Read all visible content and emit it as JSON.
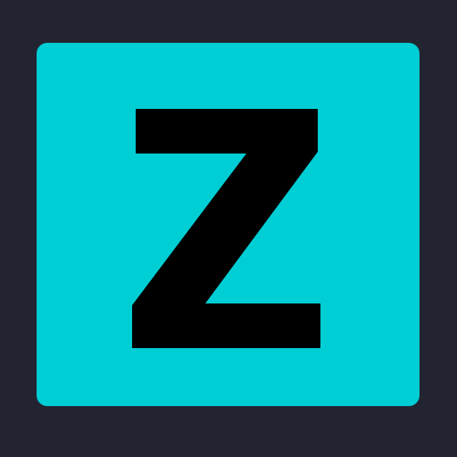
{
  "icon": {
    "letter": "Z",
    "name": "letter-z-icon",
    "colors": {
      "background": "#222531",
      "tile": "#00ced5",
      "letter": "#000000"
    }
  }
}
